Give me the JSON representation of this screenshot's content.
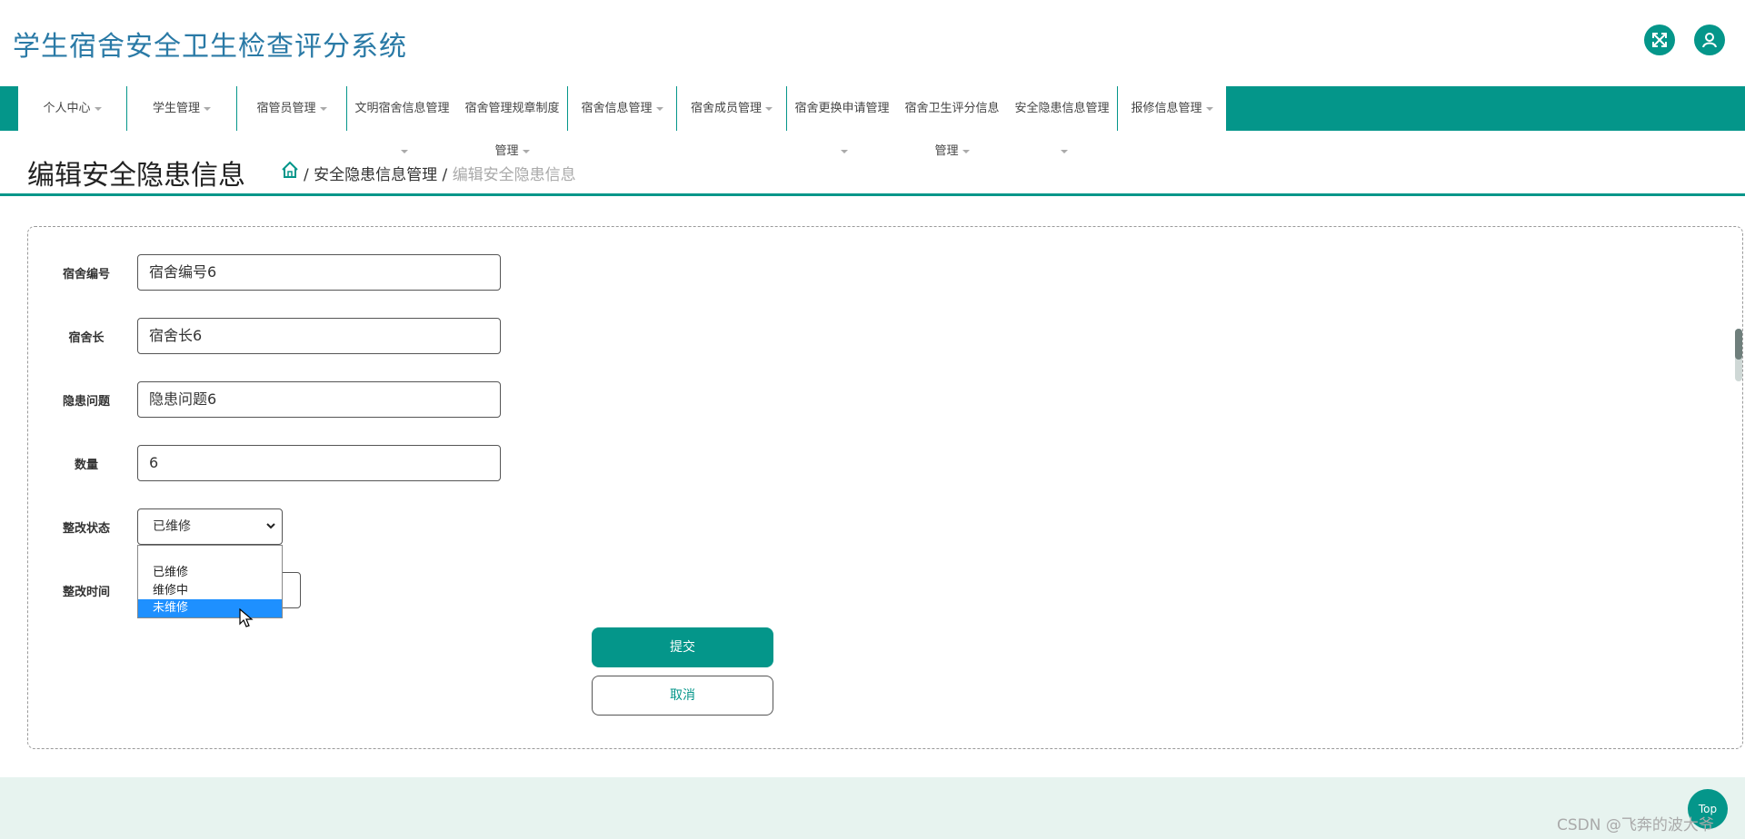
{
  "app": {
    "title": "学生宿舍安全卫生检查评分系统"
  },
  "header": {
    "fullscreen_icon": "fullscreen-icon",
    "user_icon": "user-icon"
  },
  "nav": {
    "items": [
      {
        "label": "个人中心",
        "has_caret": true
      },
      {
        "label": "学生管理",
        "has_caret": true
      },
      {
        "label": "宿管员管理",
        "has_caret": true
      },
      {
        "label": "文明宿舍信息管理",
        "has_caret": true
      },
      {
        "label": "宿舍管理规章制度",
        "sub": "管理",
        "has_caret": true
      },
      {
        "label": "宿舍信息管理",
        "has_caret": true
      },
      {
        "label": "宿舍成员管理",
        "has_caret": true
      },
      {
        "label": "宿舍更换申请管理",
        "has_caret": true
      },
      {
        "label": "宿舍卫生评分信息",
        "sub": "管理",
        "has_caret": true
      },
      {
        "label": "安全隐患信息管理",
        "has_caret": true
      },
      {
        "label": "报修信息管理",
        "has_caret": true
      }
    ]
  },
  "page": {
    "title": "编辑安全隐患信息",
    "breadcrumb": {
      "sep": "/",
      "parent": "安全隐患信息管理",
      "current": "编辑安全隐患信息"
    }
  },
  "form": {
    "fields": [
      {
        "label": "宿舍编号",
        "value": "宿舍编号6"
      },
      {
        "label": "宿舍长",
        "value": "宿舍长6"
      },
      {
        "label": "隐患问题",
        "value": "隐患问题6"
      },
      {
        "label": "数量",
        "value": "6"
      }
    ],
    "status": {
      "label": "整改状态",
      "selected": "已维修",
      "options": [
        "",
        "已维修",
        "维修中",
        "未维修"
      ],
      "highlighted": "未维修"
    },
    "time": {
      "label": "整改时间",
      "value": ""
    },
    "submit_label": "提交",
    "cancel_label": "取消"
  },
  "footer": {
    "top_label": "Top",
    "watermark": "CSDN @飞奔的波大爷"
  },
  "colors": {
    "accent": "#04968a",
    "title": "#2a7aa6",
    "highlight": "#1e90ff",
    "footer_bg": "#e7f3ef"
  }
}
